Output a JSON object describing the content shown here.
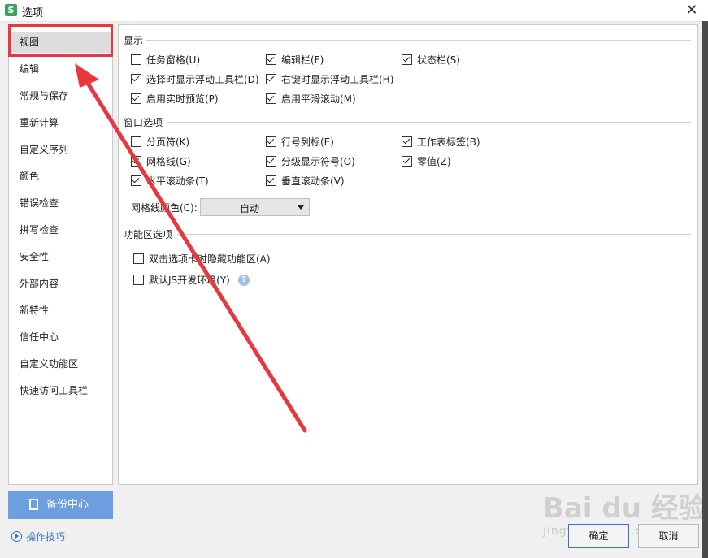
{
  "window": {
    "title": "选项",
    "app_icon": "S"
  },
  "sidebar": {
    "items": [
      {
        "label": "视图",
        "active": true
      },
      {
        "label": "编辑"
      },
      {
        "label": "常规与保存"
      },
      {
        "label": "重新计算"
      },
      {
        "label": "自定义序列"
      },
      {
        "label": "颜色"
      },
      {
        "label": "错误检查"
      },
      {
        "label": "拼写检查"
      },
      {
        "label": "安全性"
      },
      {
        "label": "外部内容"
      },
      {
        "label": "新特性"
      },
      {
        "label": "信任中心"
      },
      {
        "label": "自定义功能区"
      },
      {
        "label": "快速访问工具栏"
      }
    ]
  },
  "display": {
    "title": "显示",
    "options": [
      {
        "label": "任务窗格(U)",
        "checked": false
      },
      {
        "label": "编辑栏(F)",
        "checked": true
      },
      {
        "label": "状态栏(S)",
        "checked": true
      },
      {
        "label": "选择时显示浮动工具栏(D)",
        "checked": true
      },
      {
        "label": "右键时显示浮动工具栏(H)",
        "checked": true
      },
      {
        "label": "启用实时预览(P)",
        "checked": true
      },
      {
        "label": "启用平滑滚动(M)",
        "checked": true
      }
    ]
  },
  "window_options": {
    "title": "窗口选项",
    "options": [
      {
        "label": "分页符(K)",
        "checked": false
      },
      {
        "label": "行号列标(E)",
        "checked": true
      },
      {
        "label": "工作表标签(B)",
        "checked": true
      },
      {
        "label": "网格线(G)",
        "checked": true
      },
      {
        "label": "分级显示符号(O)",
        "checked": true
      },
      {
        "label": "零值(Z)",
        "checked": true
      },
      {
        "label": "水平滚动条(T)",
        "checked": true
      },
      {
        "label": "垂直滚动条(V)",
        "checked": true
      }
    ],
    "gridline_color_label": "网格线颜色(C):",
    "gridline_color_value": "自动"
  },
  "ribbon": {
    "title": "功能区选项",
    "options": [
      {
        "label": "双击选项卡时隐藏功能区(A)",
        "checked": false
      },
      {
        "label": "默认JS开发环境(Y)",
        "checked": false
      }
    ]
  },
  "footer": {
    "backup_label": "备份中心",
    "tips_label": "操作技巧",
    "ok_label": "确定",
    "cancel_label": "取消"
  },
  "watermark": {
    "brand": "Bai du 经验",
    "url": "jingyan.baidu.com"
  },
  "colors": {
    "accent": "#6d9fe0",
    "highlight": "#e8383d",
    "link": "#3a73c4"
  }
}
